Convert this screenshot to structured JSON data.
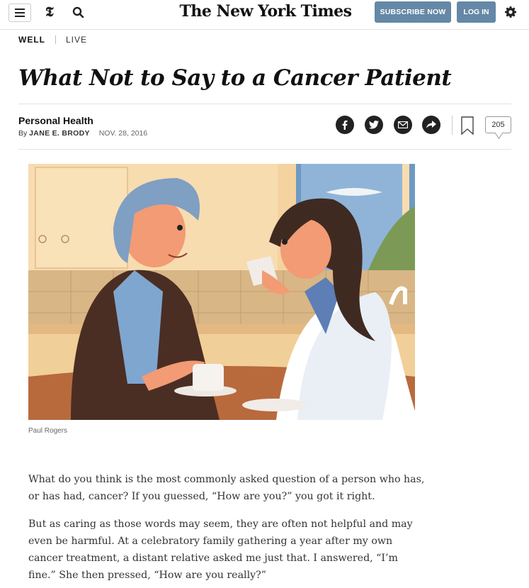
{
  "header": {
    "masthead": "The New York Times",
    "t_logo": "𝕿",
    "subscribe_label": "SUBSCRIBE NOW",
    "login_label": "LOG IN",
    "menu_icon": "hamburger-icon",
    "search_icon": "search-icon",
    "settings_icon": "gear-icon",
    "accent_color": "#6488a6"
  },
  "section_nav": {
    "section": "WELL",
    "live": "LIVE"
  },
  "article": {
    "headline": "What Not to Say to a Cancer Patient",
    "column": "Personal Health",
    "byline_prefix": "By ",
    "author": "JANE E. BRODY",
    "date": "NOV. 28, 2016",
    "comment_count": "205",
    "image_caption": "Paul Rogers",
    "paragraphs": [
      "What do you think is the most commonly asked question of a person who has, or has had, cancer? If you guessed, “How are you?” you got it right.",
      "But as caring as those words may seem, they are often not helpful and may even be harmful. At a celebratory family gathering a year after my own cancer treatment, a distant relative asked me just that. I answered, “I’m fine.” She then pressed, “How are you really?”"
    ]
  },
  "share_tools": [
    "facebook-icon",
    "twitter-icon",
    "email-icon",
    "share-icon",
    "bookmark-icon",
    "comments-icon"
  ]
}
